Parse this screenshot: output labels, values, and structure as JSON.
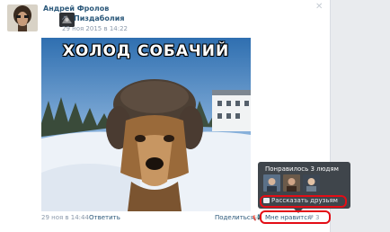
{
  "post": {
    "author_name": "Андрей Фролов",
    "close_glyph": "✕",
    "group_name": "Пиздаболия",
    "group_date": "29 ноя 2015 в 14:22",
    "repost_icon": "↗",
    "image": {
      "caption": "ХОЛОД СОБАЧИЙ",
      "subject": "dog-in-fur-hat-icon"
    },
    "footer": {
      "date": "29 ноя в 14:44",
      "separator": "|",
      "reply": "Ответить",
      "share": "Поделиться",
      "share_icon": "📢",
      "like": "Мне нравится",
      "like_heart": "♥",
      "like_count": "3"
    }
  },
  "likes_popup": {
    "title": "Понравилось 3 людям",
    "tell_friends": "Рассказать друзьям",
    "avatars": [
      "liker-avatar-1",
      "liker-avatar-2",
      "liker-avatar-3"
    ]
  },
  "colors": {
    "link": "#2b587a",
    "meta": "#8a98aa",
    "popup_bg": "#3f454b",
    "annotation_red": "#e30d16"
  }
}
